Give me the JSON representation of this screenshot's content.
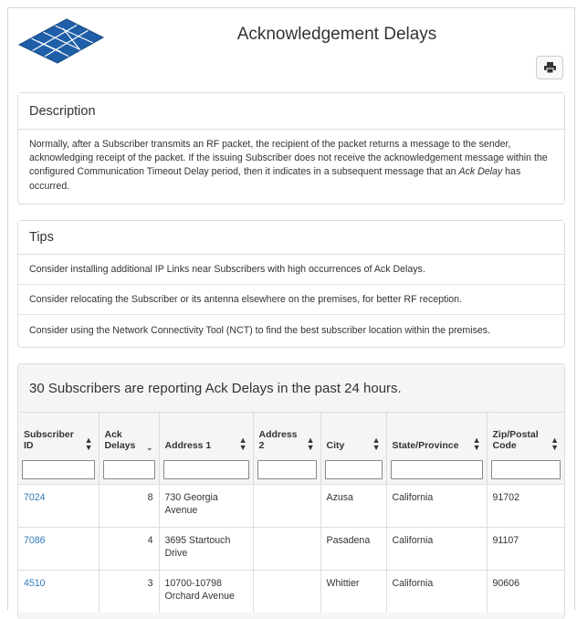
{
  "header": {
    "title": "Acknowledgement Delays",
    "logo_icon": "network-grid-logo-icon",
    "print_icon": "printer-icon"
  },
  "description": {
    "heading": "Description",
    "body_before": "Normally, after a Subscriber transmits an RF packet, the recipient of the packet returns a message to the sender, acknowledging receipt of the packet. If the issuing Subscriber does not receive the acknowledgement message within the configured Communication Timeout Delay period, then it indicates in a subsequent message that an ",
    "body_emphasis": "Ack Delay",
    "body_after": " has occurred."
  },
  "tips": {
    "heading": "Tips",
    "items": [
      "Consider installing additional IP Links near Subscribers with high occurrences of Ack Delays.",
      "Consider relocating the Subscriber or its antenna elsewhere on the premises, for better RF reception.",
      "Consider using the Network Connectivity Tool (NCT) to find the best subscriber location within the premises."
    ]
  },
  "subscribers": {
    "summary": "30 Subscribers are reporting Ack Delays in the past 24 hours.",
    "columns": {
      "subscriber_id": "Subscriber ID",
      "ack_delays": "Ack Delays",
      "address1": "Address 1",
      "address2": "Address 2",
      "city": "City",
      "state": "State/Province",
      "zip": "Zip/Postal Code"
    },
    "rows": [
      {
        "subscriber_id": "7024",
        "ack_delays": "8",
        "address1": "730 Georgia Avenue",
        "address2": "",
        "city": "Azusa",
        "state": "California",
        "zip": "91702"
      },
      {
        "subscriber_id": "7086",
        "ack_delays": "4",
        "address1": "3695 Startouch Drive",
        "address2": "",
        "city": "Pasadena",
        "state": "California",
        "zip": "91107"
      },
      {
        "subscriber_id": "4510",
        "ack_delays": "3",
        "address1": "10700-10798 Orchard Avenue",
        "address2": "",
        "city": "Whittier",
        "state": "California",
        "zip": "90606"
      }
    ]
  },
  "colors": {
    "link": "#337ab7",
    "logo": "#1f5fa8",
    "panel_bg": "#f5f5f5",
    "border": "#dddddd"
  }
}
